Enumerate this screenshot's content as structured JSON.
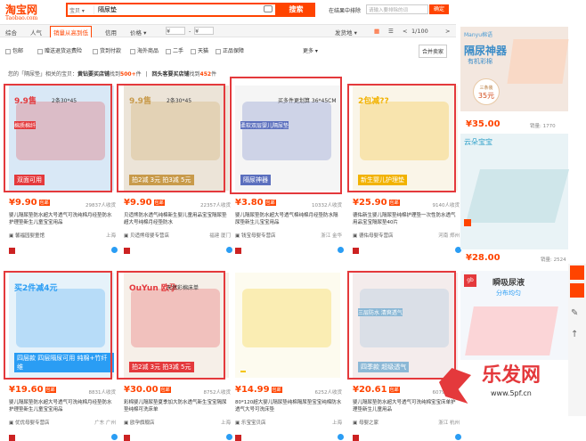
{
  "header": {
    "logo_main": "淘宝网",
    "logo_sub": "Taobao.com",
    "scope": "宝贝",
    "search_value": "隔尿垫",
    "search_button": "搜索",
    "in_results_label": "在结果中排除",
    "in_results_placeholder": "请输入要排除的词",
    "confirm_button": "确定"
  },
  "sortbar": {
    "items": [
      "综合",
      "人气",
      "销量从高到低",
      "信用",
      "价格",
      "¥",
      "¥"
    ],
    "ship_from": "发货地",
    "page": "1/100"
  },
  "filters": {
    "items": [
      "包邮",
      "赠送退货运费险",
      "货到付款",
      "海外商品",
      "二手",
      "天猫",
      "正品保障"
    ],
    "more": "更多",
    "merge": "合并卖家"
  },
  "notice": {
    "prefix": "您的「隔尿垫」相关的宝贝：",
    "a_label": "黄钻要买店铺",
    "a_mid": "找到",
    "a_count": "500+",
    "a_unit": "件",
    "sep": "|",
    "b_label": "回头客要买店铺",
    "b_mid": "找到",
    "b_count": "452",
    "b_unit": "件"
  },
  "products": [
    {
      "badge": "9.9售",
      "sub": "2条30*45",
      "bottom": "双面可用",
      "tag": "棉质棉纤",
      "price": "¥9.90",
      "sold": "29837人收货",
      "title": "婴儿隔尿垫防水超大号透气可洗纯棉月经垫防水护理垫新生儿童宝宝用品",
      "shop": "馨福园婴童馆",
      "loc": "上海"
    },
    {
      "badge": "9.9售",
      "sub": "2条30*45",
      "bottom": "拍2减 3元 拍3减 5元",
      "tag": "",
      "price": "¥9.90",
      "sold": "22357人收货",
      "title": "贝适熊防水透气纯棉新生婴儿童用品宝宝隔尿垫超大号纯棉月经垫防水",
      "shop": "贝适熊母婴专营店",
      "loc": "福建 厦门"
    },
    {
      "badge": "",
      "sub": "买多件更划算 36*45CM",
      "bottom": "隔尿神器",
      "tag": "柔软双层婴儿隔尿垫",
      "price": "¥3.80",
      "sold": "10332人收货",
      "title": "婴儿隔尿垫防水超大号透气棉纯棉月经垫防水隔尿垫新生儿宝宝用品",
      "shop": "钱宝母婴专营店",
      "loc": "浙江 金华"
    },
    {
      "badge": "2包减??",
      "sub": "",
      "bottom": "新生婴儿护理垫",
      "tag": "",
      "price": "¥25.90",
      "sold": "9140人收货",
      "title": "德佑新生婴儿隔尿垫纯棉护理垫一次性防水透气用品宝宝隔尿垫40片",
      "shop": "德佑母婴专营店",
      "loc": "河南 郑州"
    },
    {
      "badge": "买2件减4元",
      "sub": "",
      "bottom": "四层款 四层隔尿可用 纯棉+竹纤维",
      "tag": "",
      "price": "¥19.60",
      "sold": "8831人收货",
      "title": "婴儿隔尿垫防水超大号透气可洗纯棉月经垫防水护理垫新生儿童宝宝用品",
      "shop": "优优母婴专营店",
      "loc": "广东 广州"
    },
    {
      "badge": "OuYun 欧孕",
      "sub": "天然彩棉床单",
      "bottom": "拍2减 3元 拍3减 5元",
      "tag": "",
      "price": "¥30.00",
      "sold": "8752人收货",
      "title": "彩棉婴儿隔尿垫夏季加大防水透气新生宝宝隔尿垫纯棉可洗床单",
      "shop": "欧孕旗舰店",
      "loc": "上海"
    },
    {
      "badge": "",
      "sub": "",
      "bottom": "",
      "tag": "",
      "price": "¥14.99",
      "sold": "6252人收货",
      "title": "80*120超大婴儿隔尿垫纯棉隔尿垫宝宝纯棉防水透气大号可洗床垫",
      "shop": "乐宝宝贝店",
      "loc": "上海"
    },
    {
      "badge": "",
      "sub": "",
      "bottom": "四季款 超级透气",
      "tag": "三层防水 清爽透气",
      "price": "¥20.61",
      "sold": "6079人收货",
      "title": "婴儿隔尿垫防水超大号透气可洗纯棉宝宝床单护理垫新生儿童用品",
      "shop": "母婴之家",
      "loc": "浙江 杭州"
    }
  ],
  "free_ship": "包邮",
  "side": [
    {
      "brand": "Manyu棉语",
      "headline": "隔尿神器",
      "sub": "有机彩棉",
      "promo": "三条装",
      "promo_price": "35元",
      "price": "¥35.00",
      "sold": "销量: 1770"
    },
    {
      "brand": "云朵宝宝",
      "headline": "",
      "sub": "",
      "promo": "",
      "promo_price": "",
      "price": "¥28.00",
      "sold": "销量: 2524"
    },
    {
      "brand": "gb",
      "headline": "瞬吸尿液",
      "sub": "分布均匀",
      "promo": "",
      "promo_price": "",
      "price": "",
      "sold": ""
    }
  ],
  "watermark": {
    "text": "乐发网",
    "url": "www.5pf.cn"
  }
}
